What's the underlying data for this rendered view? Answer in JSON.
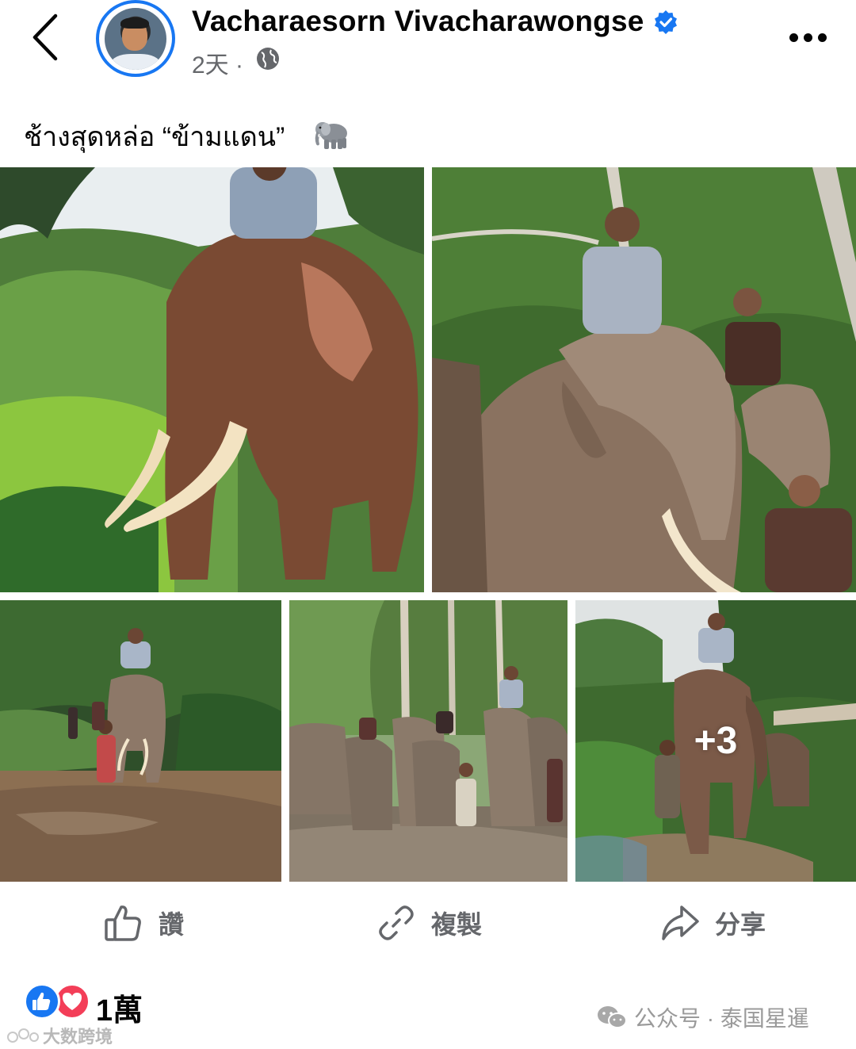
{
  "header": {
    "author_name": "Vacharaesorn Vivacharawongse",
    "post_time": "2天 ·",
    "icons": {
      "back": "chevron-left-icon",
      "verified": "verified-badge-icon",
      "privacy": "globe-icon",
      "more": "more-dots-icon"
    },
    "colors": {
      "verified": "#1877f2",
      "avatar_ring": "#1877f2"
    }
  },
  "post": {
    "caption": "ช้างสุดหล่อ “ข้ามแดน”",
    "caption_emoji": "elephant-emoji",
    "photos": [
      {
        "id": "photo-1",
        "subject": "man riding large tusked elephant in green valley"
      },
      {
        "id": "photo-2",
        "subject": "man riding elephant in forest with mahouts"
      },
      {
        "id": "photo-3",
        "subject": "elephant walking through shallow river"
      },
      {
        "id": "photo-4",
        "subject": "group of elephants with people in forest"
      },
      {
        "id": "photo-5",
        "subject": "elephant on forest trail",
        "more_count": "+3"
      }
    ]
  },
  "actions": [
    {
      "label": "讚",
      "icon": "thumbs-up-icon"
    },
    {
      "label": "複製",
      "icon": "link-icon"
    },
    {
      "label": "分享",
      "icon": "share-icon"
    }
  ],
  "reactions": {
    "count": "1萬",
    "types": [
      "like-reaction-icon",
      "love-reaction-icon"
    ],
    "colors": {
      "like": "#1877f2",
      "love": "#f33e58"
    }
  },
  "watermarks": {
    "wechat": "公众号 · 泰国星暹",
    "corner": "大数跨境"
  }
}
